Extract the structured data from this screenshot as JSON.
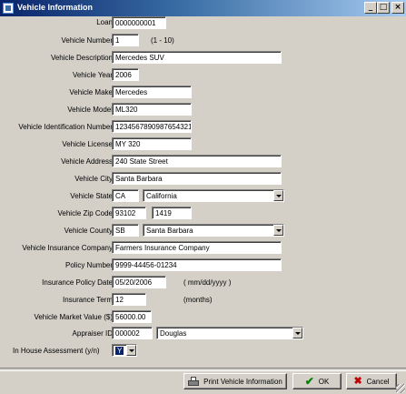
{
  "window": {
    "title": "Vehicle Information",
    "min_icon": "minimize-icon",
    "max_icon": "maximize-icon",
    "close_icon": "close-icon"
  },
  "fields": {
    "loan": {
      "label": "Loan",
      "value": "0000000001"
    },
    "vehicle_number": {
      "label": "Vehicle Number",
      "value": "1",
      "hint": "(1 - 10)"
    },
    "vehicle_description": {
      "label": "Vehicle Description",
      "value": "Mercedes SUV"
    },
    "vehicle_year": {
      "label": "Vehicle Year",
      "value": "2006"
    },
    "vehicle_make": {
      "label": "Vehicle Make",
      "value": "Mercedes"
    },
    "vehicle_model": {
      "label": "Vehicle Model",
      "value": "ML320"
    },
    "vin": {
      "label": "Vehicle Identification Number",
      "value": "1234567890987654321"
    },
    "vehicle_license": {
      "label": "Vehicle License",
      "value": "MY 320"
    },
    "vehicle_address": {
      "label": "Vehicle Address",
      "value": "240 State Street"
    },
    "vehicle_city": {
      "label": "Vehicle City",
      "value": "Santa Barbara"
    },
    "vehicle_state": {
      "label": "Vehicle State",
      "code": "CA",
      "name": "California"
    },
    "vehicle_zip": {
      "label": "Vehicle Zip Code",
      "zip": "93102",
      "plus4": "1419"
    },
    "vehicle_county": {
      "label": "Vehicle County",
      "code": "SB",
      "name": "Santa Barbara"
    },
    "insurance_company": {
      "label": "Vehicle Insurance Company",
      "value": "Farmers Insurance Company"
    },
    "policy_number": {
      "label": "Policy Number",
      "value": "9999-44456-01234"
    },
    "policy_date": {
      "label": "Insurance Policy Date",
      "value": "05/20/2006",
      "hint": "( mm/dd/yyyy )"
    },
    "insurance_term": {
      "label": "Insurance Term",
      "value": "12",
      "hint": "(months)"
    },
    "market_value": {
      "label": "Vehicle Market Value ($)",
      "value": "56000.00"
    },
    "appraiser_id": {
      "label": "Appraiser ID",
      "code": "000002",
      "name": "Douglas"
    },
    "in_house_assessment": {
      "label": "In House Assessment (y/n)",
      "value": "Y"
    }
  },
  "buttons": {
    "print": {
      "label": "Print Vehicle Information",
      "icon": "printer-icon"
    },
    "ok": {
      "label": "OK",
      "icon": "checkmark-icon"
    },
    "cancel": {
      "label": "Cancel",
      "icon": "x-icon"
    }
  },
  "colors": {
    "titlebar_start": "#0a246a",
    "titlebar_end": "#a6caf0",
    "face": "#d4d0c8"
  }
}
